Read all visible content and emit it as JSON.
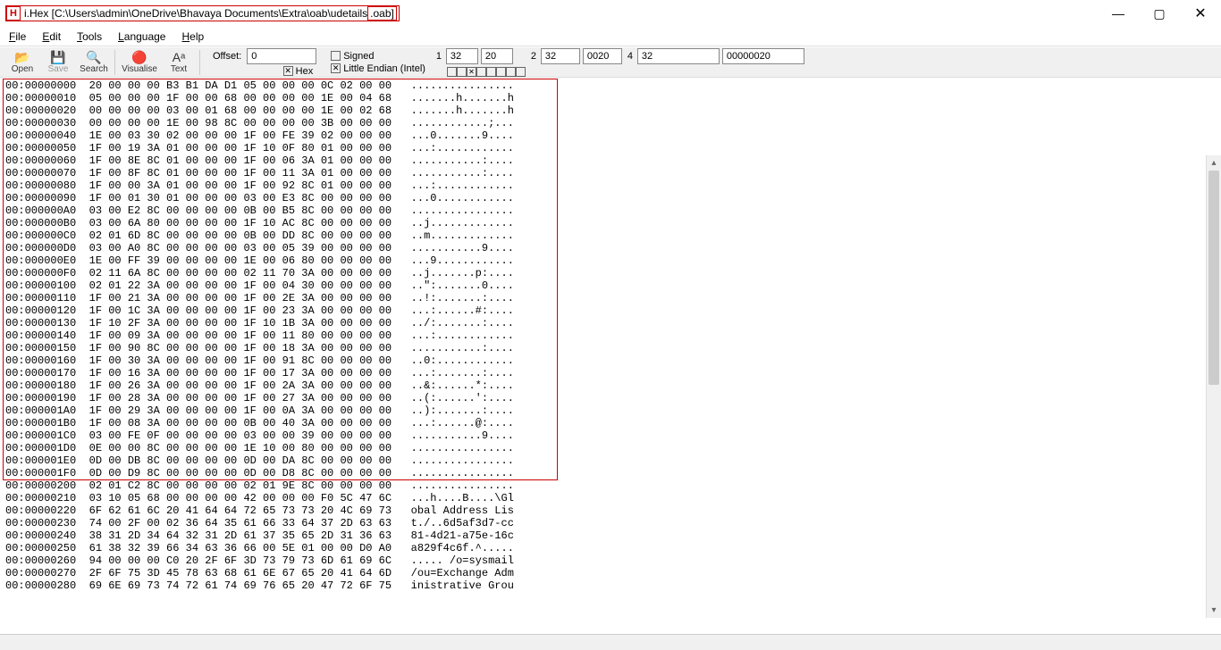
{
  "window": {
    "app_icon": "H",
    "title_prefix": "i.Hex [C:\\Users\\admin\\OneDrive\\Bhavaya Documents\\Extra\\oab\\udetails",
    "title_ext": ".oab]",
    "min": "—",
    "max": "▢",
    "close": "✕"
  },
  "menu": [
    "File",
    "Edit",
    "Tools",
    "Language",
    "Help"
  ],
  "toolbar": {
    "open": "Open",
    "save": "Save",
    "search": "Search",
    "visualise": "Visualise",
    "text": "Text",
    "offset_label": "Offset:",
    "offset_value": "0",
    "hex_label": "Hex",
    "signed": "Signed",
    "little_endian": "Little Endian (Intel)"
  },
  "numfields": {
    "g1": {
      "lbl": "1",
      "a": "32",
      "b": "20"
    },
    "g2": {
      "lbl": "2",
      "a": "32",
      "b": "0020"
    },
    "g4": {
      "lbl": "4",
      "a": "32",
      "b": "00000020"
    }
  },
  "hex_lines": [
    "00:00000000  20 00 00 00 B3 B1 DA D1 05 00 00 00 0C 02 00 00   ................",
    "00:00000010  05 00 00 00 1F 00 00 68 00 00 00 00 1E 00 04 68   .......h.......h",
    "00:00000020  00 00 00 00 03 00 01 68 00 00 00 00 1E 00 02 68   .......h.......h",
    "00:00000030  00 00 00 00 1E 00 98 8C 00 00 00 00 3B 00 00 00   ............;...",
    "00:00000040  1E 00 03 30 02 00 00 00 1F 00 FE 39 02 00 00 00   ...0.......9....",
    "00:00000050  1F 00 19 3A 01 00 00 00 1F 10 0F 80 01 00 00 00   ...:............",
    "00:00000060  1F 00 8E 8C 01 00 00 00 1F 00 06 3A 01 00 00 00   ...........:....",
    "00:00000070  1F 00 8F 8C 01 00 00 00 1F 00 11 3A 01 00 00 00   ...........:....",
    "00:00000080  1F 00 00 3A 01 00 00 00 1F 00 92 8C 01 00 00 00   ...:............",
    "00:00000090  1F 00 01 30 01 00 00 00 03 00 E3 8C 00 00 00 00   ...0............",
    "00:000000A0  03 00 E2 8C 00 00 00 00 0B 00 B5 8C 00 00 00 00   ................",
    "00:000000B0  03 00 6A 80 00 00 00 00 1F 10 AC 8C 00 00 00 00   ..j.............",
    "00:000000C0  02 01 6D 8C 00 00 00 00 0B 00 DD 8C 00 00 00 00   ..m.............",
    "00:000000D0  03 00 A0 8C 00 00 00 00 03 00 05 39 00 00 00 00   ...........9....",
    "00:000000E0  1E 00 FF 39 00 00 00 00 1E 00 06 80 00 00 00 00   ...9............",
    "00:000000F0  02 11 6A 8C 00 00 00 00 02 11 70 3A 00 00 00 00   ..j.......p:....",
    "00:00000100  02 01 22 3A 00 00 00 00 1F 00 04 30 00 00 00 00   ..\":.......0....",
    "00:00000110  1F 00 21 3A 00 00 00 00 1F 00 2E 3A 00 00 00 00   ..!:.......:....",
    "00:00000120  1F 00 1C 3A 00 00 00 00 1F 00 23 3A 00 00 00 00   ...:......#:....",
    "00:00000130  1F 10 2F 3A 00 00 00 00 1F 10 1B 3A 00 00 00 00   ../:.......:....",
    "00:00000140  1F 00 09 3A 00 00 00 00 1F 00 11 80 00 00 00 00   ...:............",
    "00:00000150  1F 00 90 8C 00 00 00 00 1F 00 18 3A 00 00 00 00   ...........:....",
    "00:00000160  1F 00 30 3A 00 00 00 00 1F 00 91 8C 00 00 00 00   ..0:............",
    "00:00000170  1F 00 16 3A 00 00 00 00 1F 00 17 3A 00 00 00 00   ...:.......:....",
    "00:00000180  1F 00 26 3A 00 00 00 00 1F 00 2A 3A 00 00 00 00   ..&:......*:....",
    "00:00000190  1F 00 28 3A 00 00 00 00 1F 00 27 3A 00 00 00 00   ..(:......':....",
    "00:000001A0  1F 00 29 3A 00 00 00 00 1F 00 0A 3A 00 00 00 00   ..):.......:....",
    "00:000001B0  1F 00 08 3A 00 00 00 00 0B 00 40 3A 00 00 00 00   ...:......@:....",
    "00:000001C0  03 00 FE 0F 00 00 00 00 03 00 00 39 00 00 00 00   ...........9....",
    "00:000001D0  0E 00 00 8C 00 00 00 00 1E 10 00 80 00 00 00 00   ................",
    "00:000001E0  0D 00 DB 8C 00 00 00 00 0D 00 DA 8C 00 00 00 00   ................",
    "00:000001F0  0D 00 D9 8C 00 00 00 00 0D 00 D8 8C 00 00 00 00   ................",
    "00:00000200  02 01 C2 8C 00 00 00 00 02 01 9E 8C 00 00 00 00   ................",
    "00:00000210  03 10 05 68 00 00 00 00 42 00 00 00 F0 5C 47 6C   ...h....B....\\Gl",
    "00:00000220  6F 62 61 6C 20 41 64 64 72 65 73 73 20 4C 69 73   obal Address Lis",
    "00:00000230  74 00 2F 00 02 36 64 35 61 66 33 64 37 2D 63 63   t./..6d5af3d7-cc",
    "00:00000240  38 31 2D 34 64 32 31 2D 61 37 35 65 2D 31 36 63   81-4d21-a75e-16c",
    "00:00000250  61 38 32 39 66 34 63 36 66 00 5E 01 00 00 D0 A0   a829f4c6f.^.....",
    "00:00000260  94 00 00 00 C0 20 2F 6F 3D 73 79 73 6D 61 69 6C   ..... /o=sysmail",
    "00:00000270  2F 6F 75 3D 45 78 63 68 61 6E 67 65 20 41 64 6D   /ou=Exchange Adm",
    "00:00000280  69 6E 69 73 74 72 61 74 69 76 65 20 47 72 6F 75   inistrative Grou"
  ]
}
